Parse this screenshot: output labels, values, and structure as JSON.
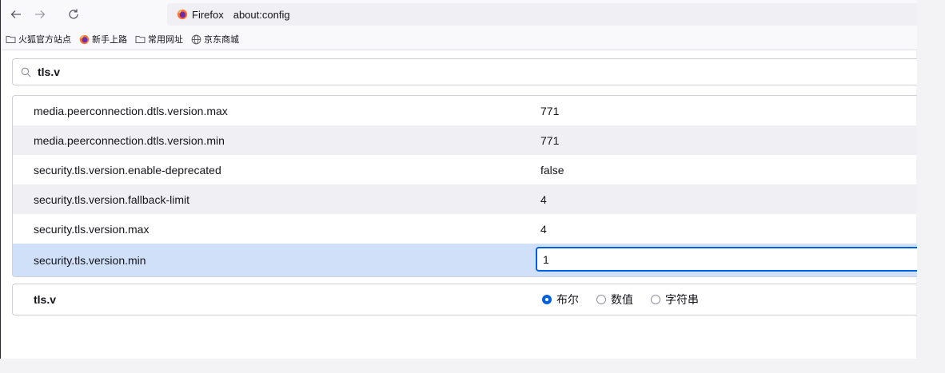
{
  "browser": {
    "identity_label": "Firefox",
    "url": "about:config"
  },
  "bookmarks": [
    {
      "label": "火狐官方站点",
      "icon": "folder-icon"
    },
    {
      "label": "新手上路",
      "icon": "firefox-icon"
    },
    {
      "label": "常用网址",
      "icon": "folder-icon"
    },
    {
      "label": "京东商城",
      "icon": "globe-icon"
    }
  ],
  "search": {
    "value": "tls.v",
    "placeholder": ""
  },
  "prefs": [
    {
      "name": "media.peerconnection.dtls.version.max",
      "value": "771"
    },
    {
      "name": "media.peerconnection.dtls.version.min",
      "value": "771"
    },
    {
      "name": "security.tls.version.enable-deprecated",
      "value": "false"
    },
    {
      "name": "security.tls.version.fallback-limit",
      "value": "4"
    },
    {
      "name": "security.tls.version.max",
      "value": "4"
    },
    {
      "name": "security.tls.version.min",
      "value": "1"
    }
  ],
  "add_pref": {
    "name": "tls.v",
    "types": [
      "布尔",
      "数值",
      "字符串"
    ],
    "selected": "布尔"
  },
  "colors": {
    "accent": "#0061e0",
    "selected_row": "#cfe0f8",
    "alt_row": "#f0f0f4"
  }
}
